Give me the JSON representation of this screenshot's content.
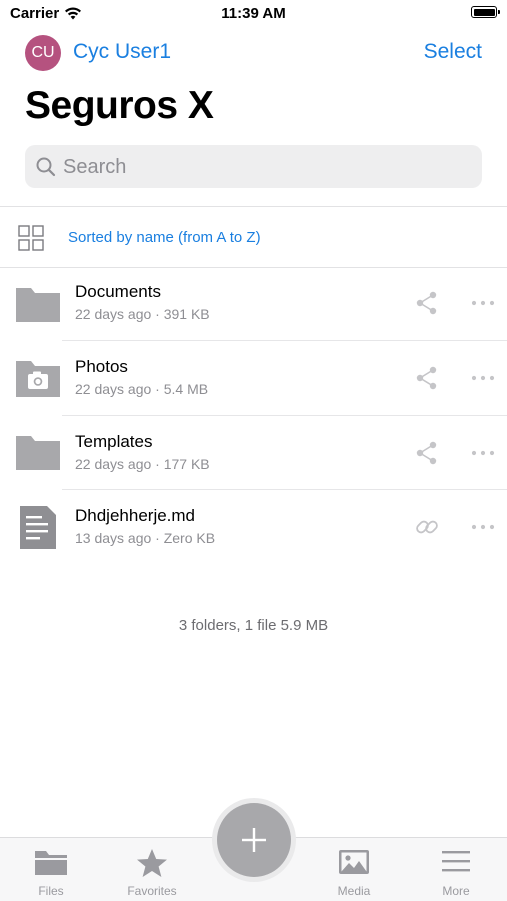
{
  "status_bar": {
    "carrier": "Carrier",
    "time": "11:39 AM"
  },
  "header": {
    "avatar_initials": "CU",
    "account_name": "Cyc User1",
    "select_label": "Select",
    "title": "Seguros X"
  },
  "search": {
    "placeholder": "Search",
    "value": ""
  },
  "sort": {
    "label": "Sorted by name (from A to Z)"
  },
  "files": [
    {
      "name": "Documents",
      "meta": "22 days ago · 391 KB",
      "type": "folder",
      "action_icon": "share-icon"
    },
    {
      "name": "Photos",
      "meta": "22 days ago · 5.4 MB",
      "type": "photo-folder",
      "action_icon": "share-icon"
    },
    {
      "name": "Templates",
      "meta": "22 days ago · 177 KB",
      "type": "folder",
      "action_icon": "share-icon"
    },
    {
      "name": "Dhdjehherje.md",
      "meta": "13 days ago · Zero KB",
      "type": "document",
      "action_icon": "link-icon"
    }
  ],
  "summary": "3 folders, 1 file 5.9 MB",
  "tabs": [
    {
      "label": "Files",
      "icon": "folder-icon"
    },
    {
      "label": "Favorites",
      "icon": "star-icon"
    },
    {
      "label": "Media",
      "icon": "image-icon"
    },
    {
      "label": "More",
      "icon": "menu-icon"
    }
  ],
  "colors": {
    "accent": "#1a7fe0",
    "avatar": "#b5527f",
    "icon_gray": "#a8a8ab",
    "secondary_text": "#8e8e93"
  }
}
